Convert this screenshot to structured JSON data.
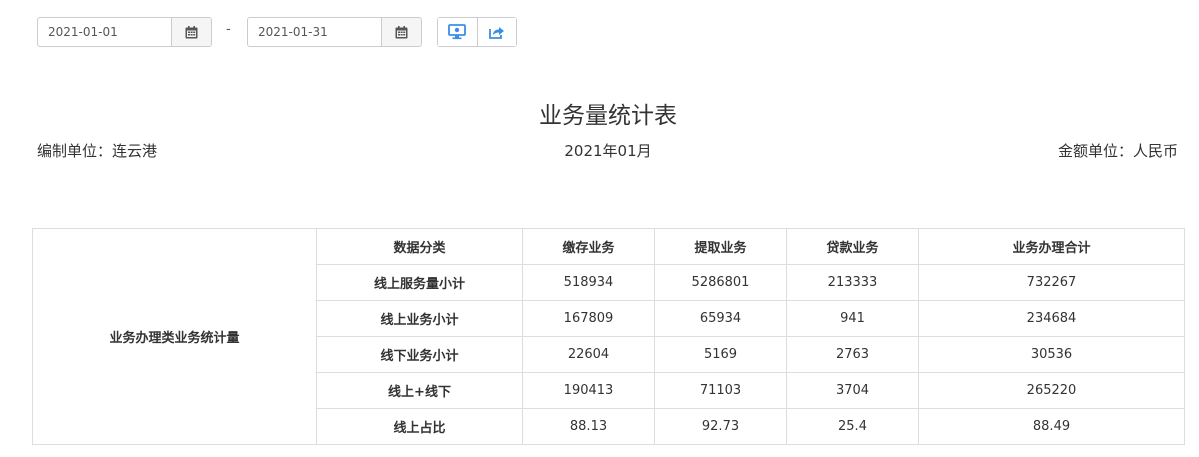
{
  "filters": {
    "start_date": "2021-01-01",
    "end_date": "2021-01-31",
    "separator": "-",
    "calendar_icon": "calendar-icon",
    "actions": [
      {
        "name": "preview-report-button",
        "icon": "monitor-icon"
      },
      {
        "name": "export-button",
        "icon": "share-export-icon"
      }
    ]
  },
  "report": {
    "title": "业务量统计表",
    "unit_label": "编制单位：连云港",
    "period": "2021年01月",
    "currency_label": "金额单位：人民币"
  },
  "table": {
    "group_label": "业务办理类业务统计量",
    "headers": [
      "数据分类",
      "缴存业务",
      "提取业务",
      "贷款业务",
      "业务办理合计"
    ],
    "rows": [
      {
        "label": "线上服务量小计",
        "values": [
          "518934",
          "5286801",
          "213333",
          "732267"
        ]
      },
      {
        "label": "线上业务小计",
        "values": [
          "167809",
          "65934",
          "941",
          "234684"
        ]
      },
      {
        "label": "线下业务小计",
        "values": [
          "22604",
          "5169",
          "2763",
          "30536"
        ]
      },
      {
        "label": "线上+线下",
        "values": [
          "190413",
          "71103",
          "3704",
          "265220"
        ]
      },
      {
        "label": "线上占比",
        "values": [
          "88.13",
          "92.73",
          "25.4",
          "88.49"
        ]
      }
    ]
  },
  "colors": {
    "border": "#dddddd",
    "text": "#333333",
    "icon_blue": "#3a8ee6"
  }
}
